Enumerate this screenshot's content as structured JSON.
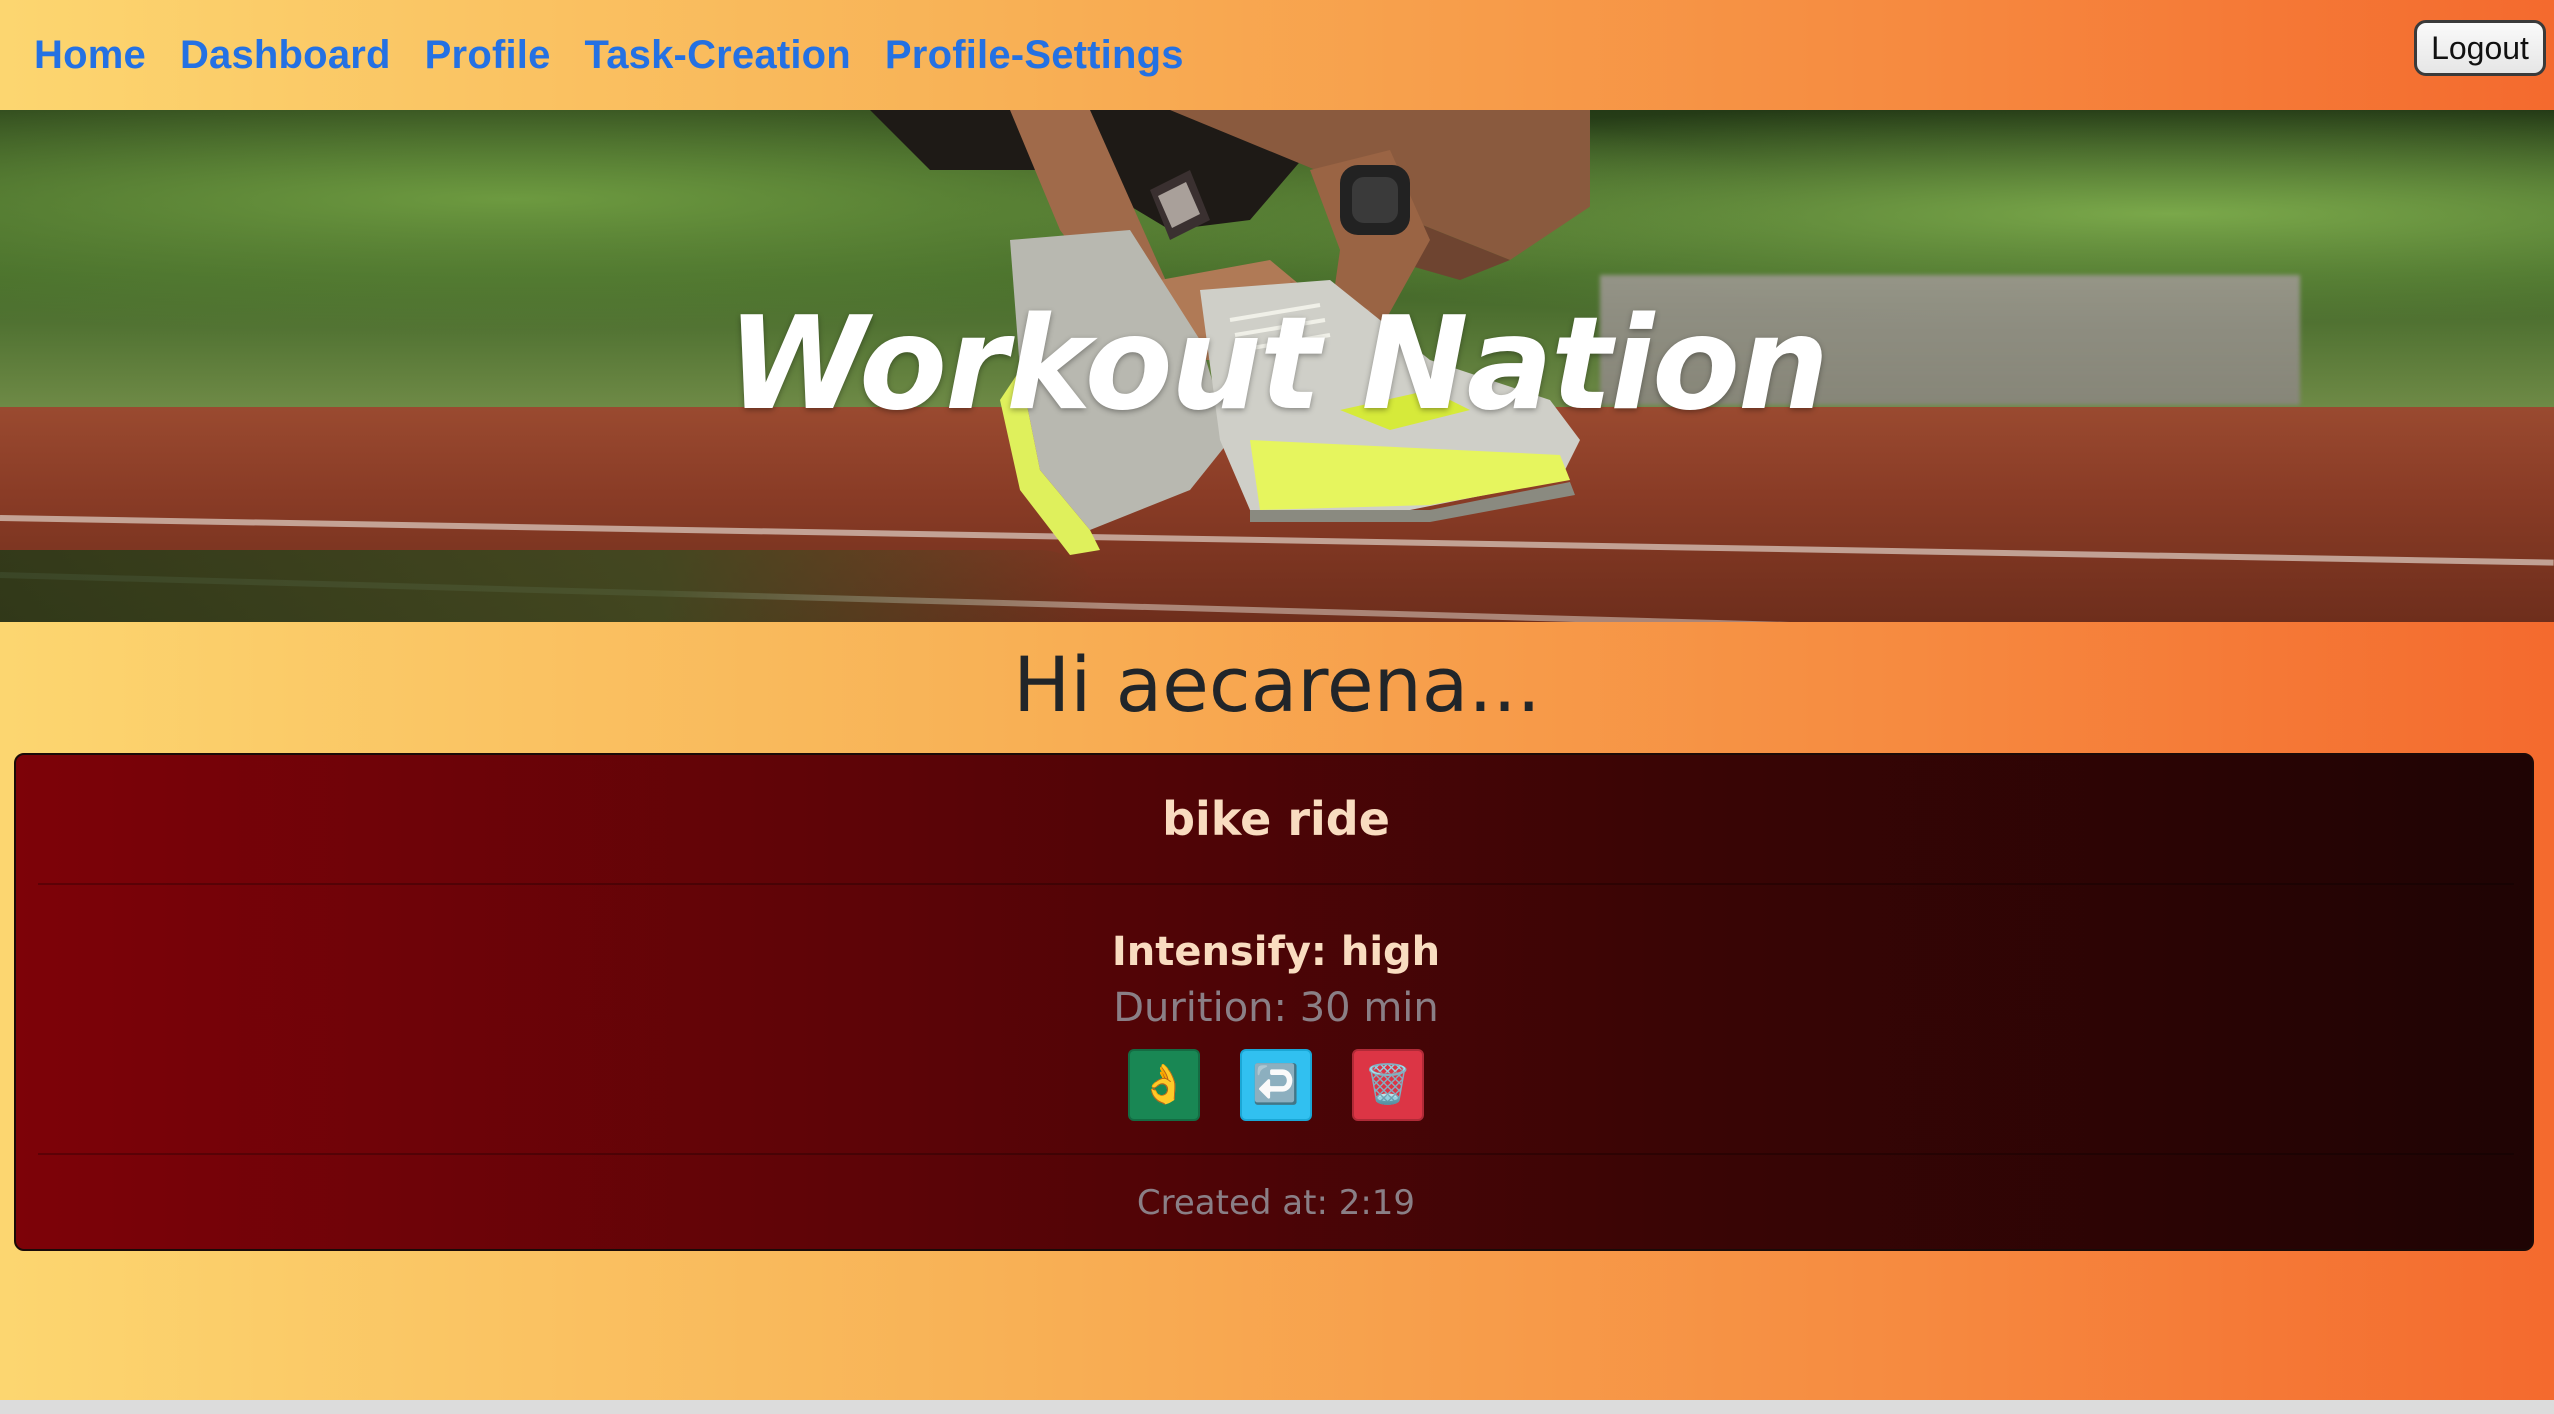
{
  "nav": {
    "links": [
      {
        "label": "Home"
      },
      {
        "label": "Dashboard"
      },
      {
        "label": "Profile"
      },
      {
        "label": "Task-Creation"
      },
      {
        "label": "Profile-Settings"
      }
    ],
    "logout_label": "Logout",
    "link_color": "#2471e3"
  },
  "hero": {
    "title": "Workout Nation",
    "image_subject": "runner-tying-shoe-on-track"
  },
  "greeting": "Hi aecarena...",
  "task_card": {
    "title": "bike ride",
    "intensity": "Intensify: high",
    "duration": "Durition: 30 min",
    "actions": [
      {
        "icon": "ok-hand-icon",
        "glyph": "👌",
        "color": "#198754"
      },
      {
        "icon": "return-arrow-icon",
        "glyph": "↩️",
        "color": "#31c0f0"
      },
      {
        "icon": "wastebasket-icon",
        "glyph": "🗑️",
        "color": "#dc3545"
      }
    ],
    "created_at": "Created at: 2:19"
  },
  "colors": {
    "background_gradient_start": "#fcd670",
    "background_gradient_end": "#f46a2e",
    "card_gradient_start": "#7d0208",
    "card_gradient_end": "#1f0404"
  }
}
